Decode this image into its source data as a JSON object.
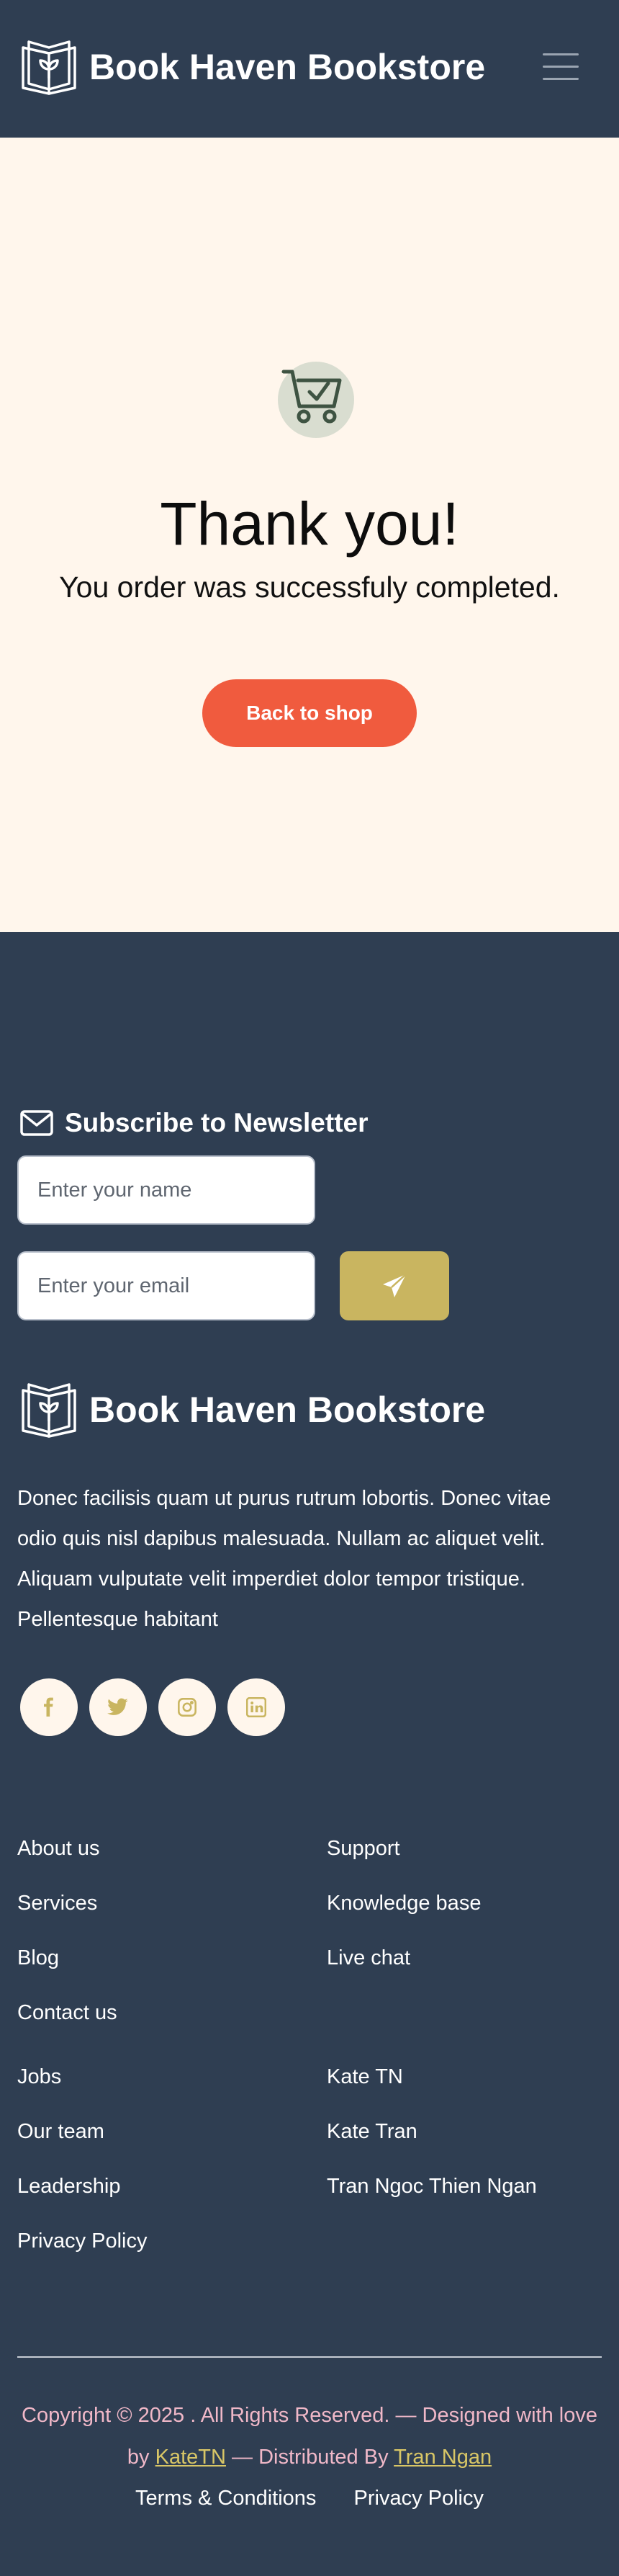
{
  "header": {
    "title": "Book Haven Bookstore",
    "logo_icon": "open-book-logo-icon",
    "menu_icon": "hamburger-menu-icon"
  },
  "hero": {
    "cart_icon": "cart-check-icon",
    "heading": "Thank you!",
    "message": "You order was successfuly completed.",
    "button_label": "Back to shop"
  },
  "newsletter": {
    "heading": "Subscribe to Newsletter",
    "icon": "envelope-icon",
    "name_placeholder": "Enter your name",
    "email_placeholder": "Enter your email",
    "send_icon": "paper-plane-icon"
  },
  "footer": {
    "brand_title": "Book Haven Bookstore",
    "description": "Donec facilisis quam ut purus rutrum lobortis. Donec vitae odio quis nisl dapibus malesuada. Nullam ac aliquet velit. Aliquam vulputate velit imperdiet dolor tempor tristique. Pellentesque habitant",
    "socials": [
      "facebook-icon",
      "twitter-icon",
      "instagram-icon",
      "linkedin-icon"
    ],
    "links_left_1": [
      "About us",
      "Services",
      "Blog",
      "Contact us"
    ],
    "links_right_1": [
      "Support",
      "Knowledge base",
      "Live chat"
    ],
    "links_left_2": [
      "Jobs",
      "Our team",
      "Leadership",
      "Privacy Policy"
    ],
    "links_right_2": [
      "Kate TN",
      "Kate Tran",
      "Tran Ngoc Thien Ngan"
    ],
    "copyright_prefix": "Copyright © 2025 . All Rights Reserved. — Designed with love by",
    "designer": "KateTN",
    "distributed_text": "— Distributed By",
    "distributor": "Tran Ngan",
    "legal_terms": "Terms & Conditions",
    "legal_privacy": "Privacy Policy"
  },
  "colors": {
    "navy": "#2f3e52",
    "cream": "#fff6ec",
    "accent_orange": "#f05b3e",
    "gold": "#c9b560",
    "pink_text": "#f0b8c8"
  }
}
